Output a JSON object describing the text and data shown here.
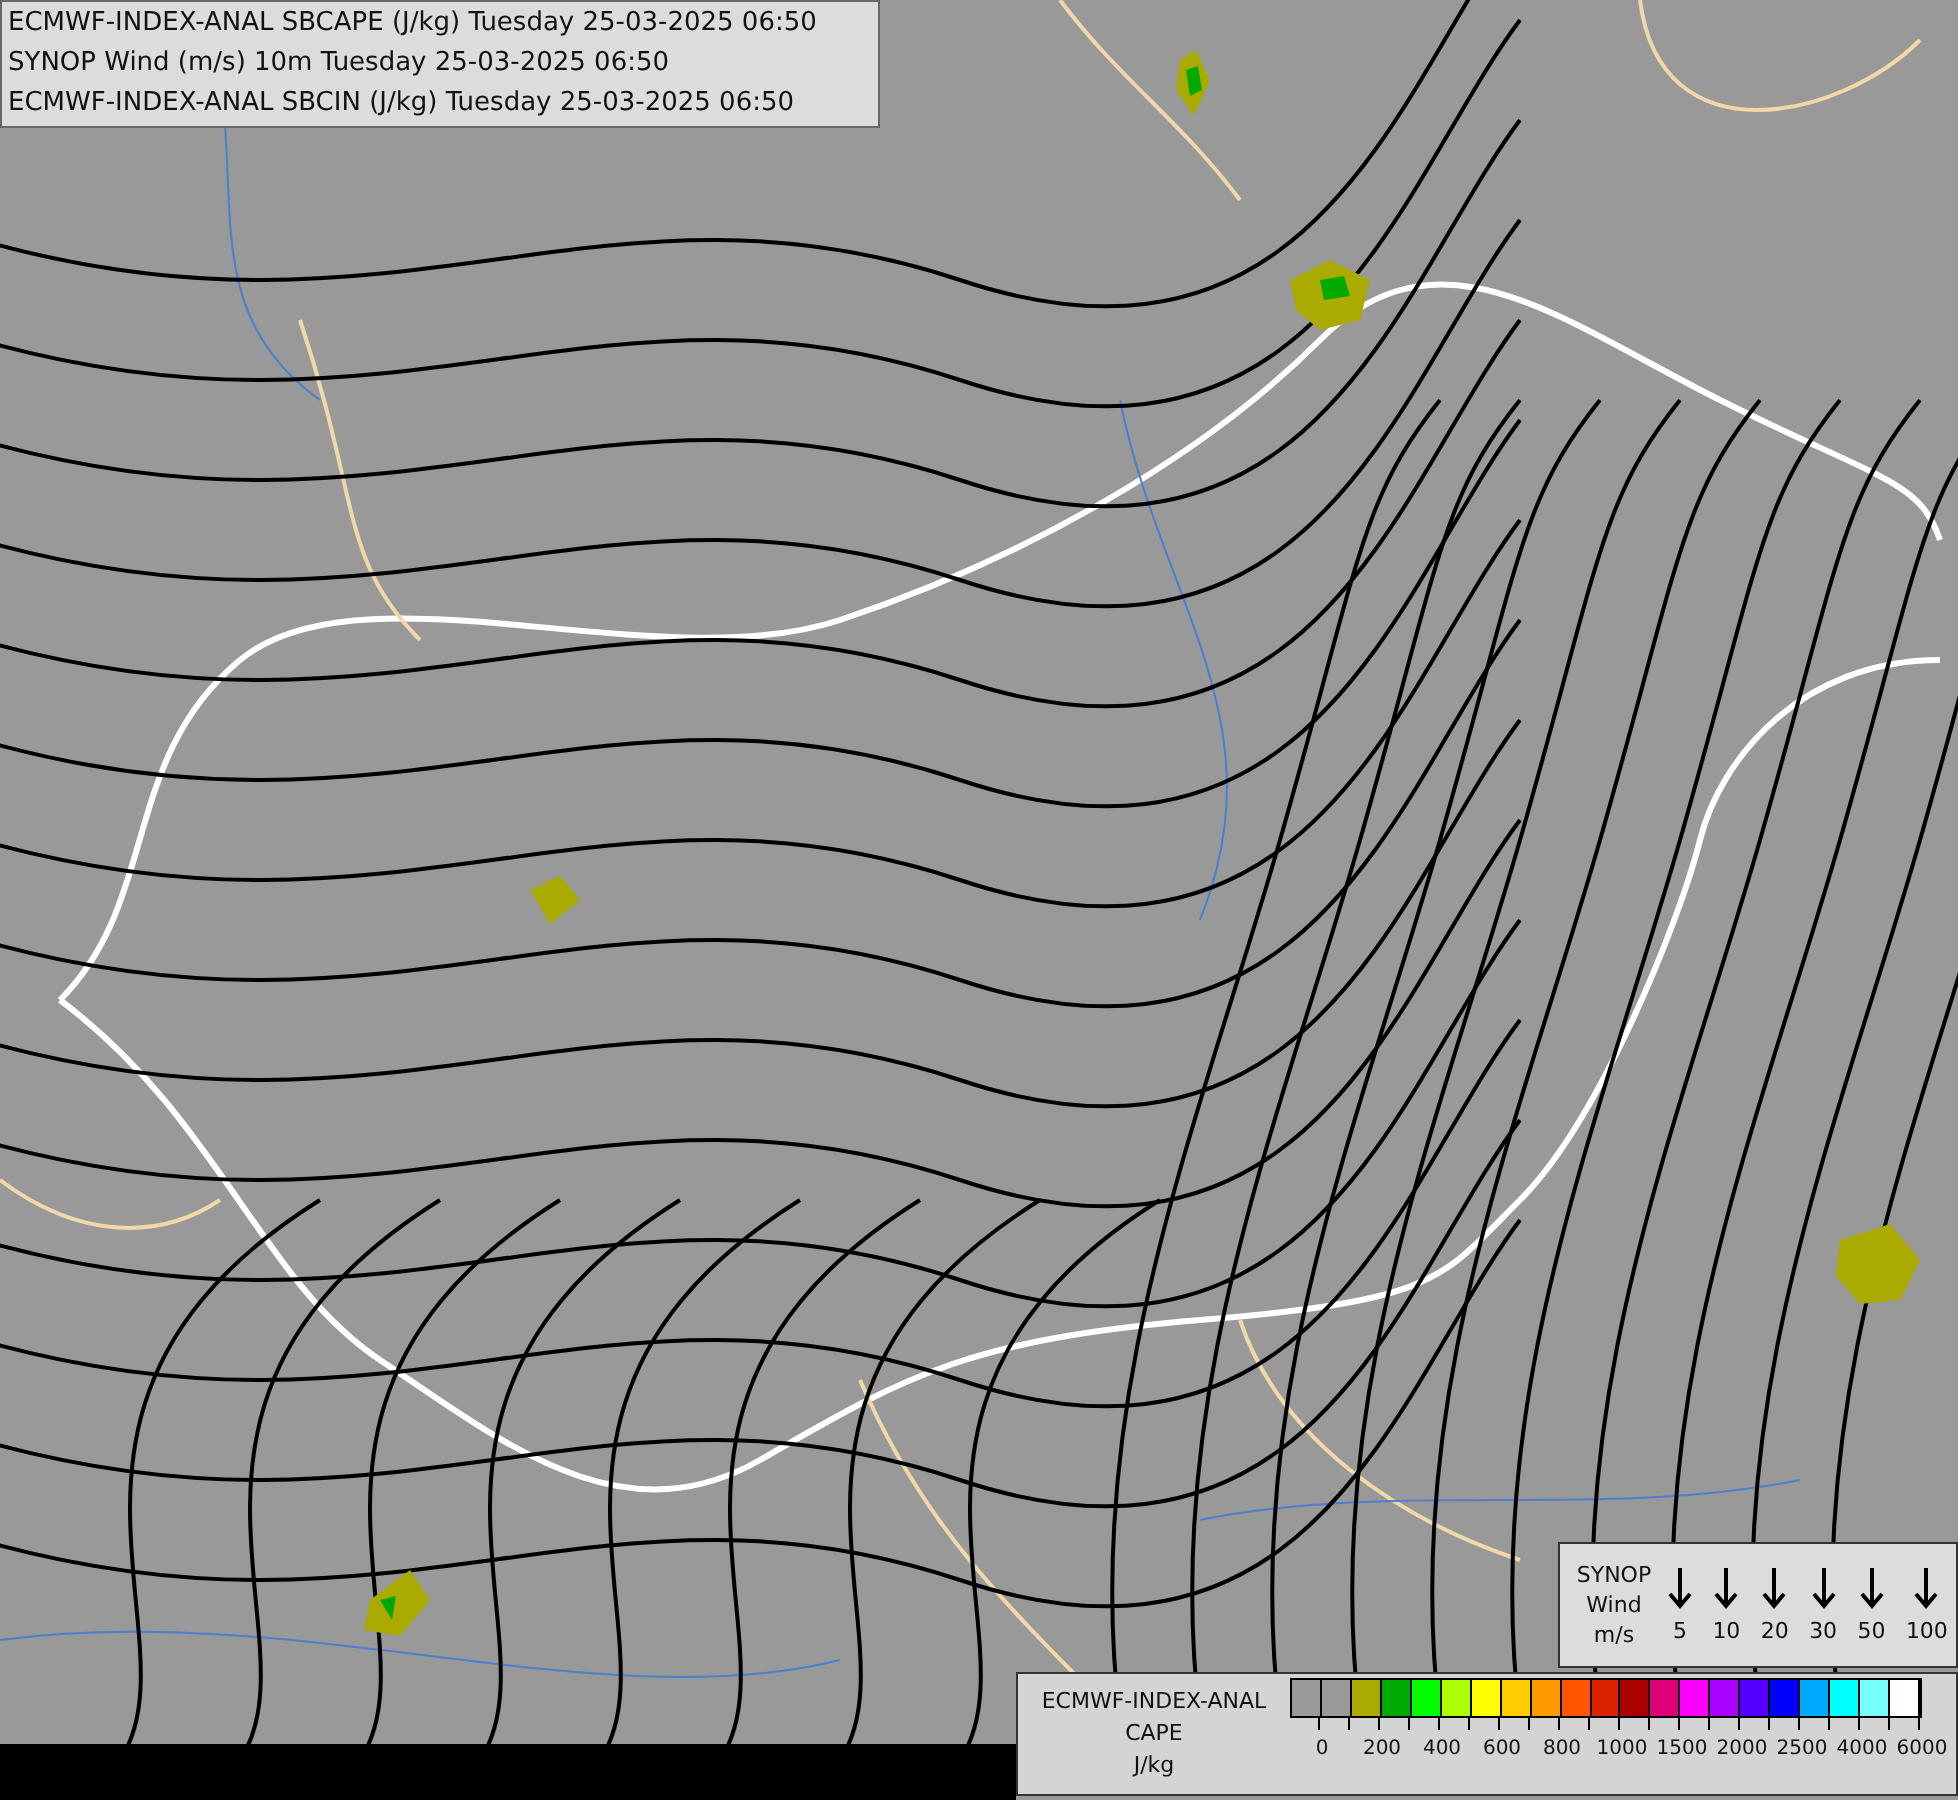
{
  "title_box": {
    "lines": [
      "ECMWF-INDEX-ANAL SBCAPE (J/kg) Tuesday 25-03-2025 06:50",
      "SYNOP Wind (m/s) 10m Tuesday 25-03-2025 06:50",
      "ECMWF-INDEX-ANAL SBCIN (J/kg) Tuesday 25-03-2025 06:50"
    ]
  },
  "wind_legend": {
    "title_lines": [
      "SYNOP",
      "Wind",
      "m/s"
    ],
    "entries": [
      {
        "label": "5"
      },
      {
        "label": "10"
      },
      {
        "label": "20"
      },
      {
        "label": "30"
      },
      {
        "label": "50"
      },
      {
        "label": "100"
      }
    ]
  },
  "cape_legend": {
    "title_lines": [
      "ECMWF-INDEX-ANAL",
      "CAPE",
      "J/kg"
    ],
    "swatches": [
      {
        "color": "#999999"
      },
      {
        "color": "#999999"
      },
      {
        "color": "#aaaa00"
      },
      {
        "color": "#00aa00"
      },
      {
        "color": "#00ff00"
      },
      {
        "color": "#aaff00"
      },
      {
        "color": "#ffff00"
      },
      {
        "color": "#ffcc00"
      },
      {
        "color": "#ff9900"
      },
      {
        "color": "#ff5500"
      },
      {
        "color": "#dd2200"
      },
      {
        "color": "#aa0000"
      },
      {
        "color": "#dd0077"
      },
      {
        "color": "#ff00ff"
      },
      {
        "color": "#aa00ff"
      },
      {
        "color": "#5500ff"
      },
      {
        "color": "#0000ff"
      },
      {
        "color": "#00aaff"
      },
      {
        "color": "#00ffff"
      },
      {
        "color": "#77ffff"
      },
      {
        "color": "#ffffff"
      }
    ],
    "labels": [
      "0",
      "200",
      "400",
      "600",
      "800",
      "1000",
      "1500",
      "2000",
      "2500",
      "4000",
      "6000"
    ]
  }
}
